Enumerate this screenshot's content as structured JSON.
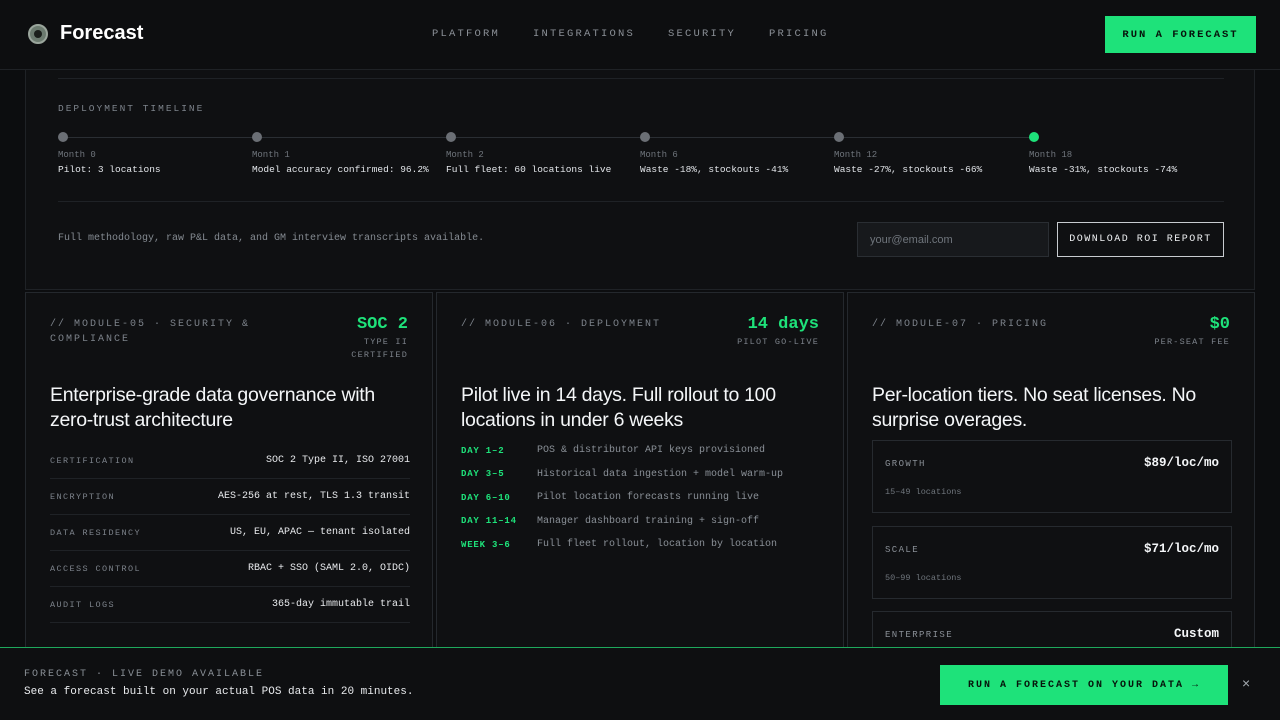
{
  "nav": {
    "brand": "Forecast",
    "links": [
      "PLATFORM",
      "INTEGRATIONS",
      "SECURITY",
      "PRICING"
    ],
    "cta": "RUN A FORECAST"
  },
  "timeline": {
    "label": "DEPLOYMENT TIMELINE",
    "items": [
      {
        "month": "Month 0",
        "text": "Pilot: 3 locations",
        "active": false
      },
      {
        "month": "Month 1",
        "text": "Model accuracy confirmed: 96.2%",
        "active": false
      },
      {
        "month": "Month 2",
        "text": "Full fleet: 60 locations live",
        "active": false
      },
      {
        "month": "Month 6",
        "text": "Waste -18%, stockouts -41%",
        "active": false
      },
      {
        "month": "Month 12",
        "text": "Waste -27%, stockouts -66%",
        "active": false
      },
      {
        "month": "Month 18",
        "text": "Waste -31%, stockouts -74%",
        "active": true
      }
    ]
  },
  "report": {
    "note": "Full methodology, raw P&L data, and GM interview transcripts available.",
    "email_placeholder": "your@email.com",
    "email_value": "",
    "button": "DOWNLOAD ROI REPORT"
  },
  "security": {
    "tag": "// MODULE-05 · SECURITY & COMPLIANCE",
    "stat": "SOC 2",
    "stat_sub": "TYPE II CERTIFIED",
    "title": "Enterprise-grade data governance with zero-trust architecture",
    "specs": [
      {
        "key": "CERTIFICATION",
        "value": "SOC 2 Type II, ISO 27001"
      },
      {
        "key": "ENCRYPTION",
        "value": "AES-256 at rest, TLS 1.3 transit"
      },
      {
        "key": "DATA RESIDENCY",
        "value": "US, EU, APAC — tenant isolated"
      },
      {
        "key": "ACCESS CONTROL",
        "value": "RBAC + SSO (SAML 2.0, OIDC)"
      },
      {
        "key": "AUDIT LOGS",
        "value": "365-day immutable trail"
      }
    ]
  },
  "deployment": {
    "tag": "// MODULE-06 · DEPLOYMENT",
    "stat": "14 days",
    "stat_sub": "PILOT GO-LIVE",
    "title": "Pilot live in 14 days. Full rollout to 100 locations in under 6 weeks",
    "steps": [
      {
        "day": "DAY 1–2",
        "desc": "POS & distributor API keys provisioned"
      },
      {
        "day": "DAY 3–5",
        "desc": "Historical data ingestion + model warm-up"
      },
      {
        "day": "DAY 6–10",
        "desc": "Pilot location forecasts running live"
      },
      {
        "day": "DAY 11–14",
        "desc": "Manager dashboard training + sign-off"
      },
      {
        "day": "WEEK 3–6",
        "desc": "Full fleet rollout, location by location"
      }
    ]
  },
  "pricing": {
    "tag": "// MODULE-07 · PRICING",
    "stat": "$0",
    "stat_sub": "PER-SEAT FEE",
    "title": "Per-location tiers. No seat licenses. No surprise overages.",
    "tiers": [
      {
        "name": "GROWTH",
        "price": "$89/loc/mo",
        "sub": "15–49 locations"
      },
      {
        "name": "SCALE",
        "price": "$71/loc/mo",
        "sub": "50–99 locations"
      },
      {
        "name": "ENTERPRISE",
        "price": "Custom",
        "sub": ""
      }
    ]
  },
  "banner": {
    "tag": "FORECAST · LIVE DEMO AVAILABLE",
    "text": "See a forecast built on your actual POS data in 20 minutes.",
    "cta": "RUN A FORECAST ON YOUR DATA →",
    "close": "×"
  }
}
